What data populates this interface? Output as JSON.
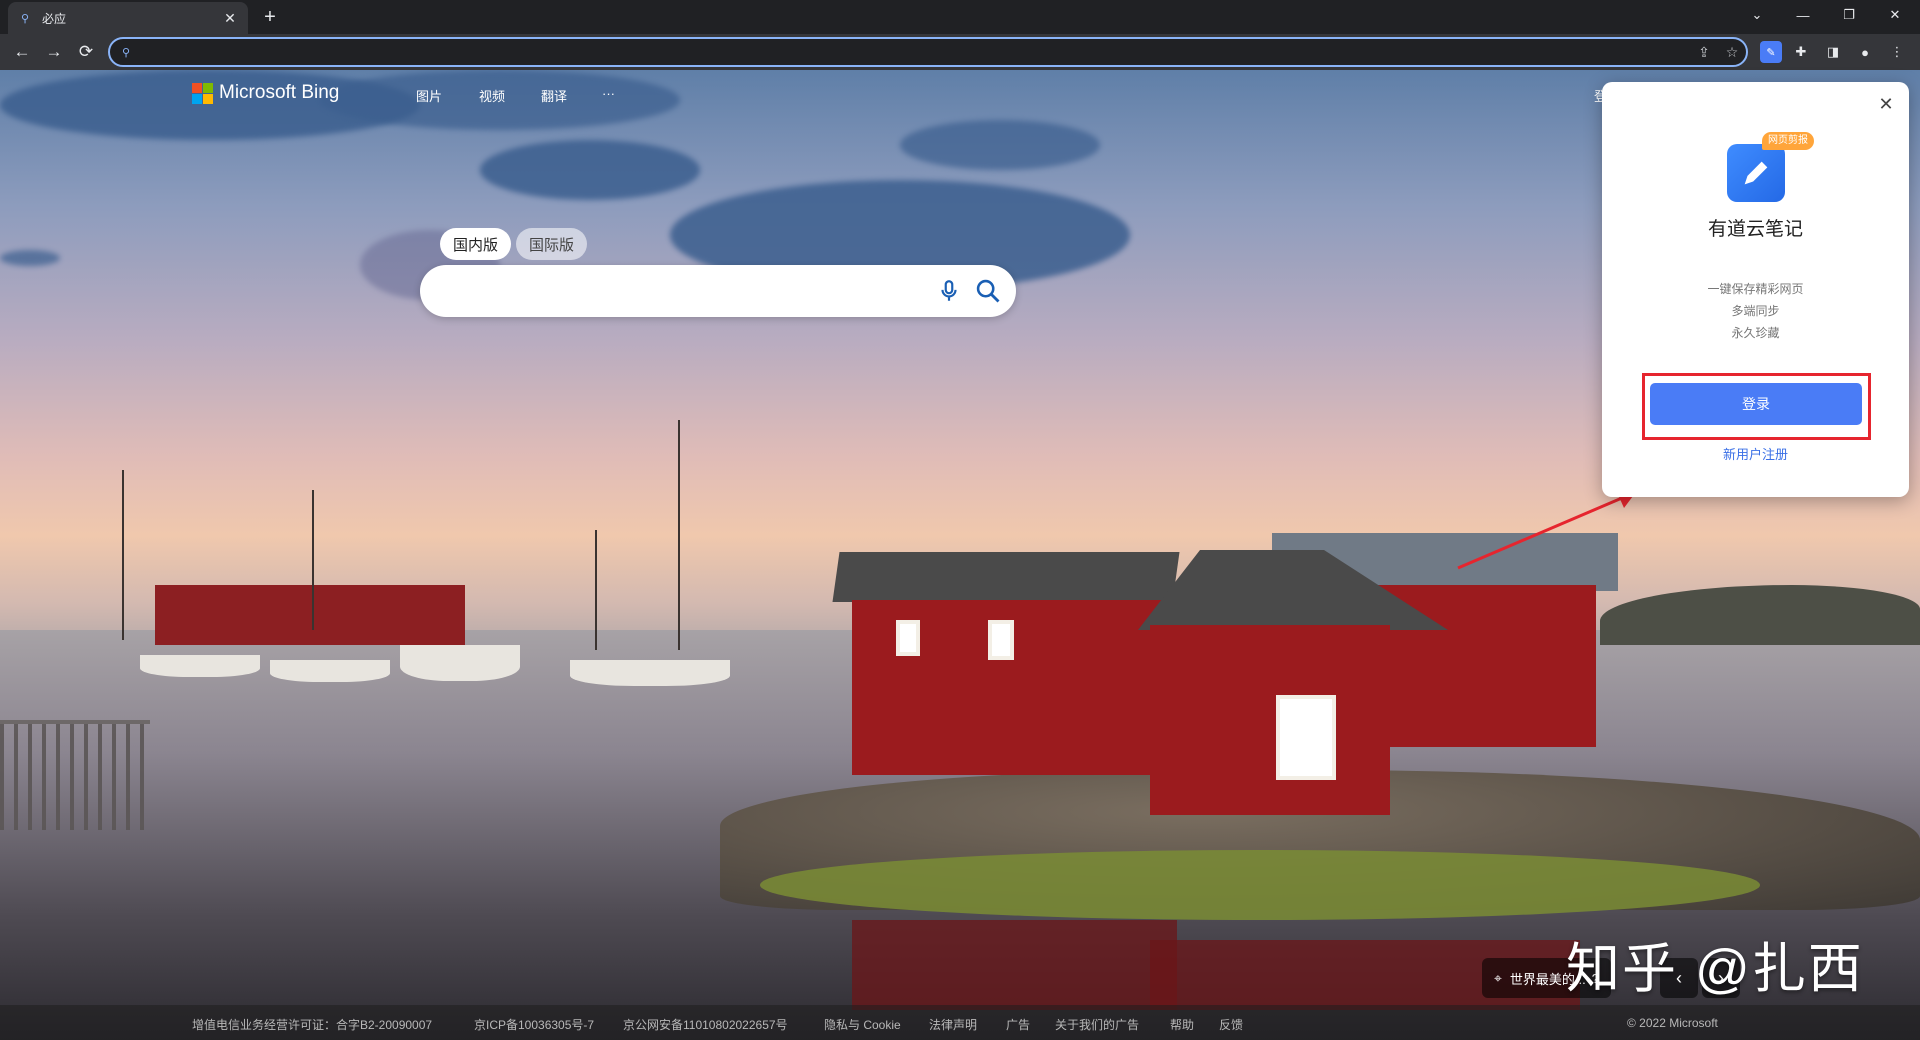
{
  "browser": {
    "tab_title": "必应",
    "omnibox_value": ""
  },
  "bing": {
    "logo_text": "Microsoft Bing",
    "nav": [
      "图片",
      "视频",
      "翻译",
      "···"
    ],
    "signin_partial": "登",
    "region_tabs": {
      "domestic": "国内版",
      "international": "国际版"
    },
    "search_value": "",
    "location_text": "世界最美的...",
    "question_mark": "?"
  },
  "footer": {
    "links": [
      "增值电信业务经营许可证：合字B2-20090007",
      "京ICP备10036305号-7",
      "京公网安备11010802022657号",
      "隐私与 Cookie",
      "法律声明",
      "广告",
      "关于我们的广告",
      "帮助",
      "反馈"
    ],
    "copyright": "© 2022 Microsoft"
  },
  "youdao_popup": {
    "badge": "网页剪报",
    "app_name": "有道云笔记",
    "features": [
      "一键保存精彩网页",
      "多端同步",
      "永久珍藏"
    ],
    "login_label": "登录",
    "register_label": "新用户注册"
  },
  "watermark": "知乎 @扎西",
  "colors": {
    "omnibox_focus": "#8ab4f8",
    "youdao_button": "#4a7cf6",
    "annotation_red": "#e6252e"
  }
}
